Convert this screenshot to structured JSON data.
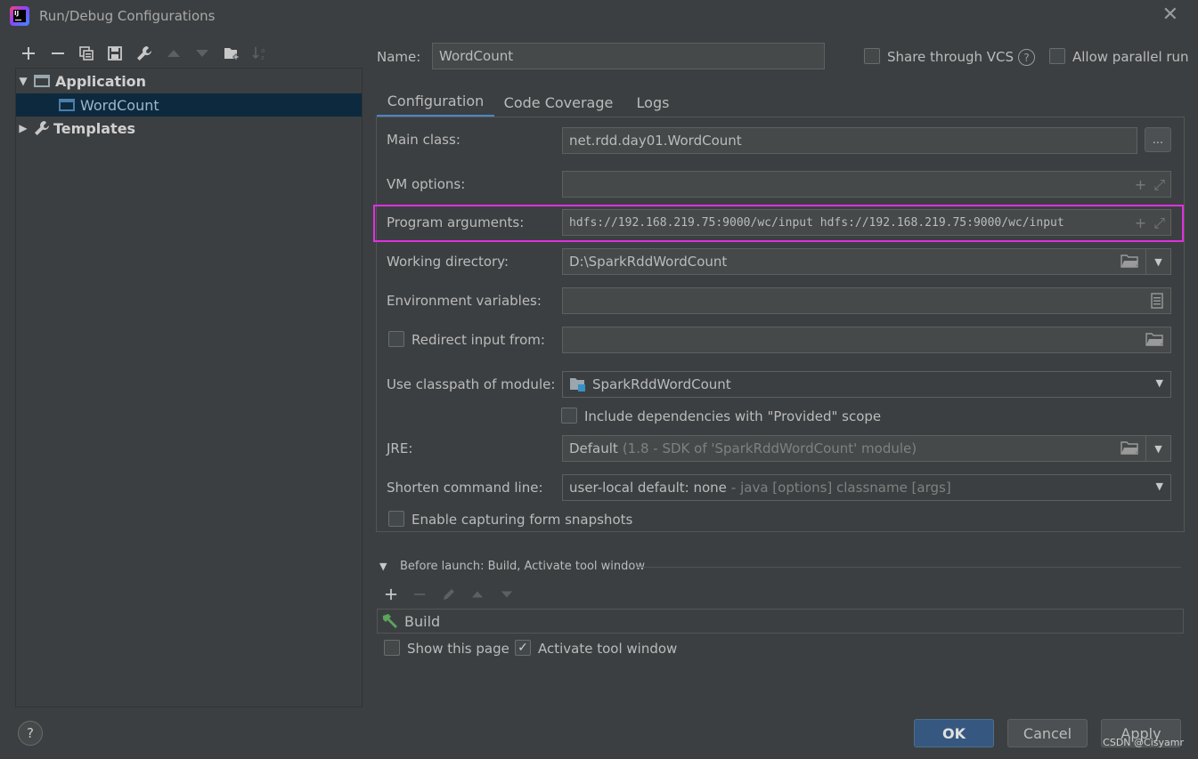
{
  "window": {
    "title": "Run/Debug Configurations",
    "close_glyph": "✕"
  },
  "toolbar": {
    "icons": [
      "add-icon",
      "remove-icon",
      "copy-icon",
      "save-icon",
      "wrench-icon",
      "move-up-icon",
      "move-down-icon",
      "new-folder-icon",
      "sort-icon"
    ]
  },
  "tree": {
    "items": [
      {
        "label": "Application",
        "expanded": true
      },
      {
        "label": "WordCount",
        "selected": true
      },
      {
        "label": "Templates",
        "expanded": false
      }
    ]
  },
  "name": {
    "label": "Name:",
    "value": "WordCount"
  },
  "options": {
    "share_vcs": "Share through VCS",
    "allow_parallel": "Allow parallel run"
  },
  "tabs": [
    {
      "label": "Configuration",
      "active": true
    },
    {
      "label": "Code Coverage",
      "active": false
    },
    {
      "label": "Logs",
      "active": false
    }
  ],
  "config": {
    "main_class_label": "Main class:",
    "main_class_value": "net.rdd.day01.WordCount",
    "browse_label": "...",
    "vm_options_label": "VM options:",
    "vm_options_value": "",
    "program_args_label": "Program arguments:",
    "program_args_value": "hdfs://192.168.219.75:9000/wc/input hdfs://192.168.219.75:9000/wc/input",
    "working_dir_label": "Working directory:",
    "working_dir_value": "D:\\SparkRddWordCount",
    "env_vars_label": "Environment variables:",
    "env_vars_value": "",
    "redirect_label": "Redirect input from:",
    "redirect_value": "",
    "classpath_label": "Use classpath of module:",
    "classpath_value": "SparkRddWordCount",
    "include_deps_label": "Include dependencies with \"Provided\" scope",
    "jre_label": "JRE:",
    "jre_value": "Default",
    "jre_hint": "(1.8 - SDK of 'SparkRddWordCount' module)",
    "shorten_label": "Shorten command line:",
    "shorten_value": "user-local default: none",
    "shorten_hint": "- java [options] classname [args]",
    "snapshots_label": "Enable capturing form snapshots"
  },
  "before_launch": {
    "title": "Before launch: Build, Activate tool window",
    "task": "Build",
    "show_page_label": "Show this page",
    "show_page_checked": false,
    "activate_label": "Activate tool window",
    "activate_checked": true
  },
  "buttons": {
    "ok": "OK",
    "cancel": "Cancel",
    "apply": "Apply",
    "help": "?"
  },
  "watermark": "CSDN @Cisyamr",
  "colors": {
    "background": "#3c3f41",
    "selection": "#0d293e",
    "accent_tab": "#4a88c7",
    "highlight_box": "#e030e0",
    "primary_button": "#365880"
  }
}
